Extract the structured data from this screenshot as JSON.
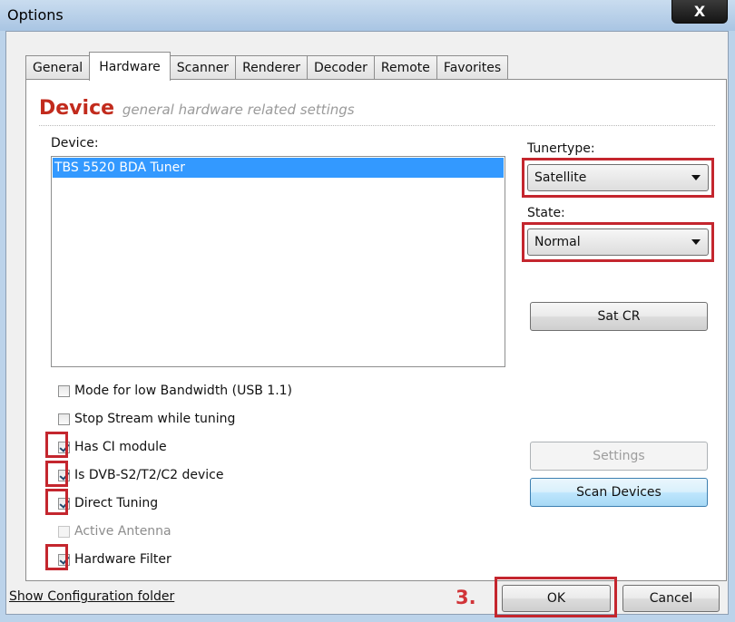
{
  "window": {
    "title": "Options",
    "close_label": "X"
  },
  "tabs": [
    {
      "label": "General"
    },
    {
      "label": "Hardware"
    },
    {
      "label": "Scanner"
    },
    {
      "label": "Renderer"
    },
    {
      "label": "Decoder"
    },
    {
      "label": "Remote"
    },
    {
      "label": "Favorites"
    }
  ],
  "header": {
    "title": "Device",
    "subtitle": "general hardware related settings"
  },
  "device": {
    "label": "Device:",
    "items": [
      "TBS 5520 BDA Tuner"
    ],
    "selected_index": 0
  },
  "tunertype": {
    "label": "Tunertype:",
    "value": "Satellite"
  },
  "state": {
    "label": "State:",
    "value": "Normal"
  },
  "buttons": {
    "sat_cr": "Sat CR",
    "settings": "Settings",
    "scan_devices": "Scan Devices",
    "ok": "OK",
    "cancel": "Cancel"
  },
  "checkboxes": [
    {
      "label": "Mode for low Bandwidth (USB 1.1)",
      "checked": false,
      "enabled": true
    },
    {
      "label": "Stop Stream while tuning",
      "checked": false,
      "enabled": true
    },
    {
      "label": "Has CI module",
      "checked": true,
      "enabled": true
    },
    {
      "label": "Is DVB-S2/T2/C2 device",
      "checked": true,
      "enabled": true
    },
    {
      "label": "Direct Tuning",
      "checked": true,
      "enabled": true
    },
    {
      "label": "Active Antenna",
      "checked": false,
      "enabled": false
    },
    {
      "label": "Hardware Filter",
      "checked": true,
      "enabled": true
    }
  ],
  "footer": {
    "config_link": "Show Configuration folder"
  },
  "annotation": {
    "step_label": "3.",
    "highlight_color": "#c4262e"
  },
  "colors": {
    "accent_red": "#c22b1d",
    "selection_blue": "#3399ff"
  }
}
